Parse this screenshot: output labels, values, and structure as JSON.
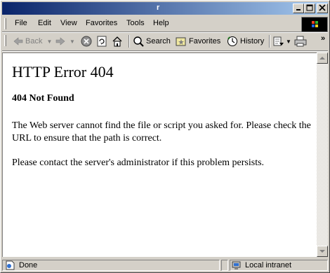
{
  "window": {
    "title": "r"
  },
  "menu": {
    "items": [
      "File",
      "Edit",
      "View",
      "Favorites",
      "Tools",
      "Help"
    ]
  },
  "toolbar": {
    "back_label": "Back",
    "search_label": "Search",
    "favorites_label": "Favorites",
    "history_label": "History",
    "overflow": "»"
  },
  "content": {
    "heading": "HTTP Error 404",
    "subheading": "404 Not Found",
    "paragraph1": "The Web server cannot find the file or script you asked for. Please check the URL to ensure that the path is correct.",
    "paragraph2": "Please contact the server's administrator if this problem persists."
  },
  "status": {
    "text": "Done",
    "zone": "Local intranet"
  },
  "colors": {
    "titlebar_start": "#0a246a",
    "titlebar_end": "#a6caf0",
    "chrome": "#d4d0c8"
  },
  "icons": [
    "back-arrow-icon",
    "forward-arrow-icon",
    "stop-icon",
    "refresh-icon",
    "home-icon",
    "search-icon",
    "favorites-icon",
    "history-icon",
    "mail-icon",
    "print-icon",
    "page-done-icon",
    "intranet-icon",
    "windows-logo-icon"
  ]
}
